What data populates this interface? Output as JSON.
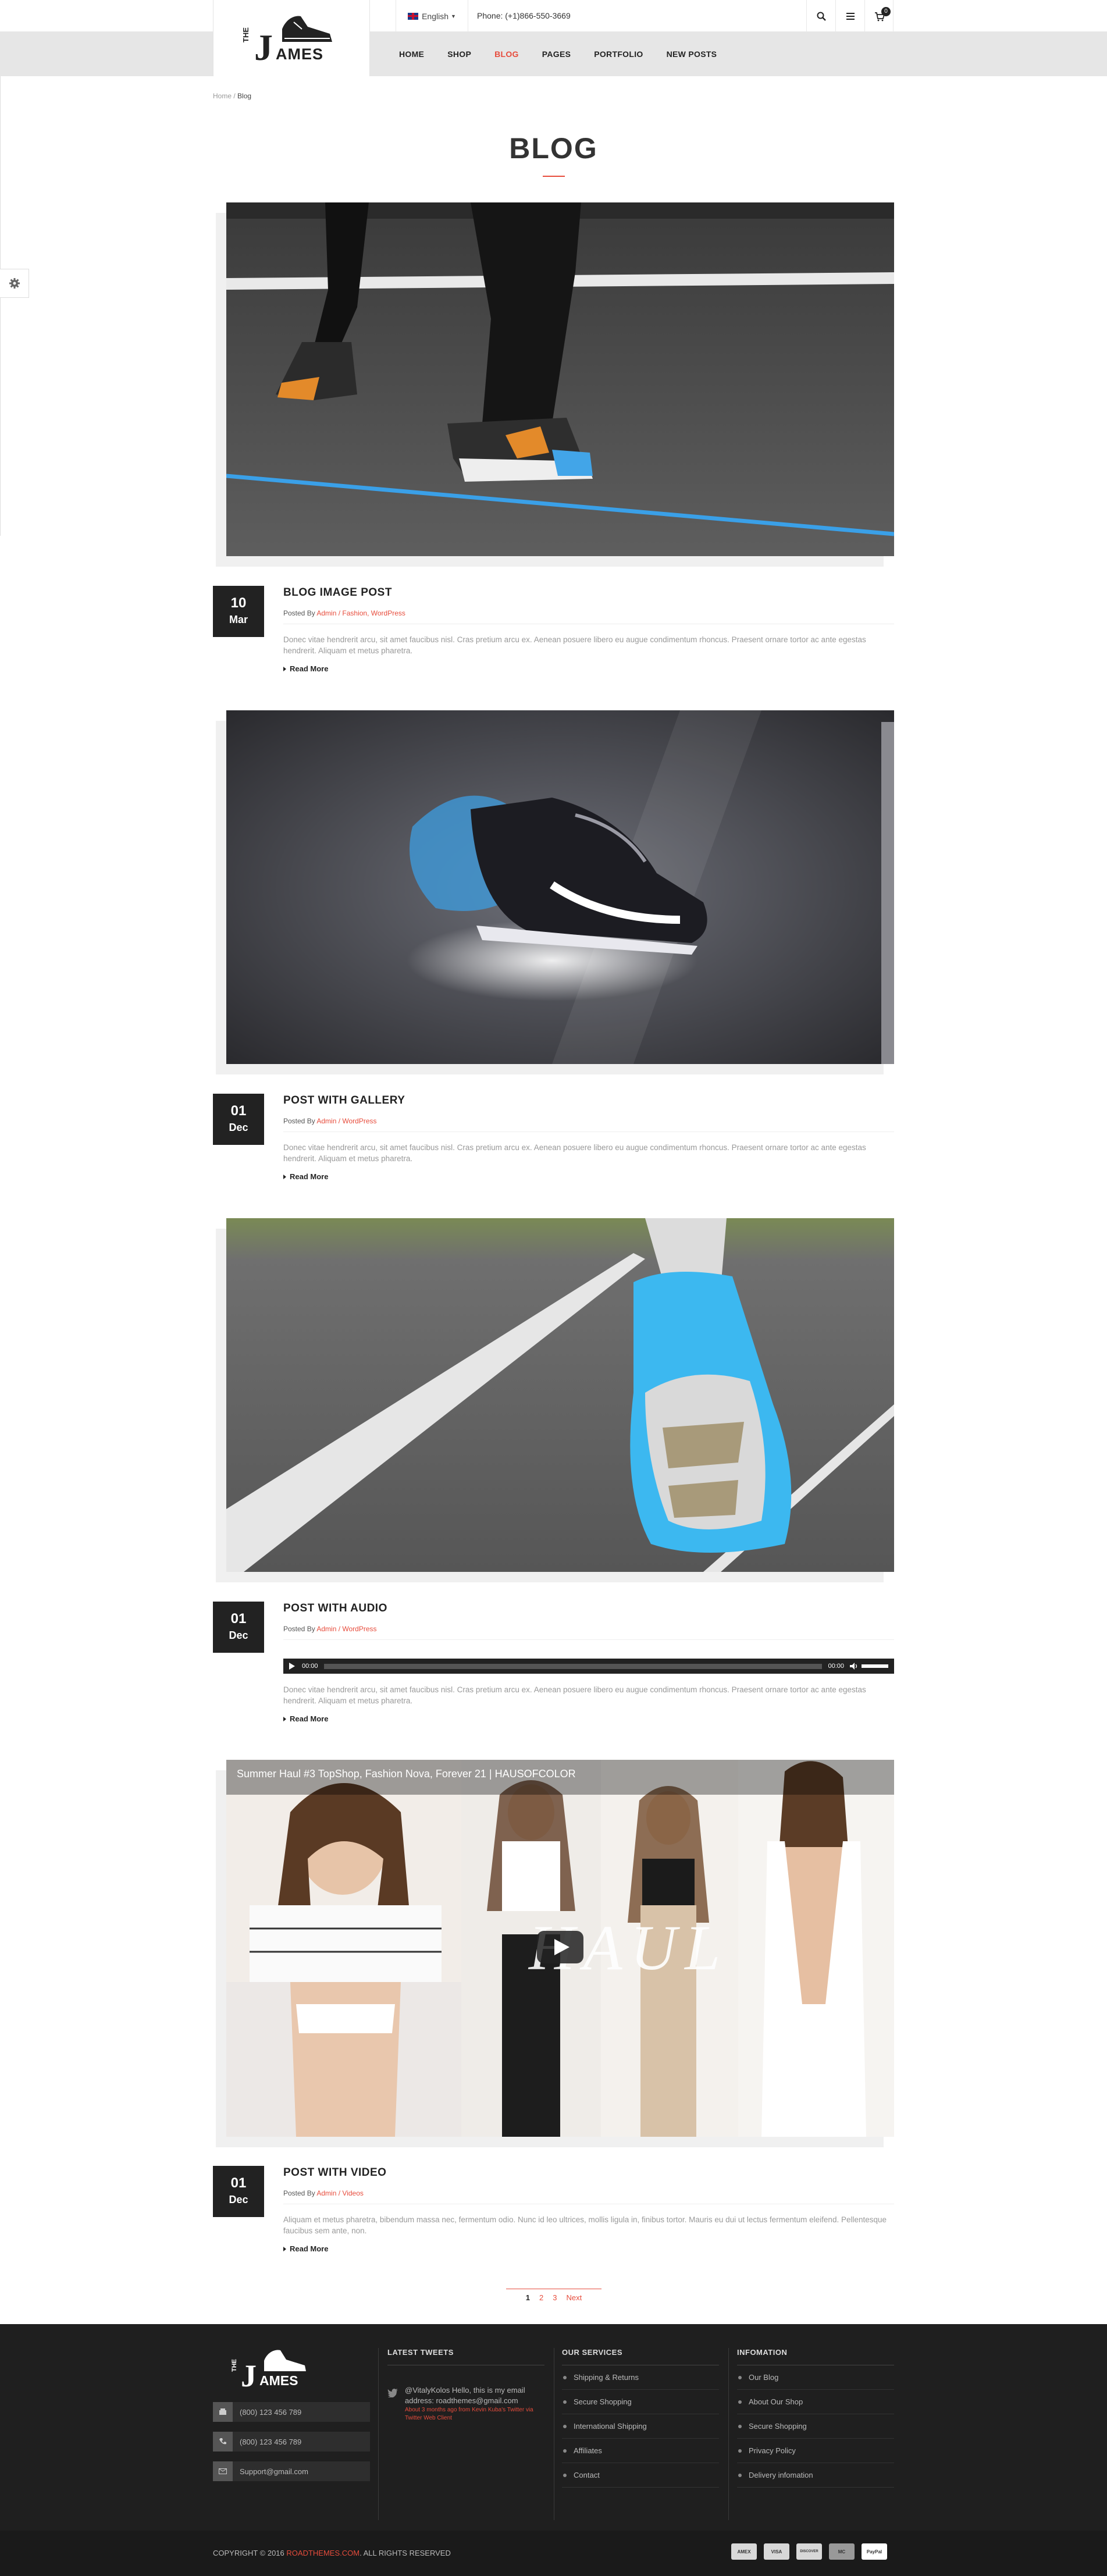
{
  "topbar": {
    "language": "English",
    "phone": "Phone: (+1)866-550-3669",
    "cart_count": "0"
  },
  "brand": {
    "logo_small": "THE",
    "logo_letter": "J",
    "logo_rest": "AMES"
  },
  "nav": {
    "items": [
      {
        "label": "HOME"
      },
      {
        "label": "SHOP"
      },
      {
        "label": "BLOG"
      },
      {
        "label": "PAGES"
      },
      {
        "label": "PORTFOLIO"
      },
      {
        "label": "NEW POSTS"
      }
    ],
    "active": "BLOG"
  },
  "breadcrumb": {
    "home": "Home",
    "separator": "/",
    "current": "Blog"
  },
  "page_title": "BLOG",
  "posts": [
    {
      "day": "10",
      "month": "Mar",
      "title": "BLOG IMAGE POST",
      "posted_by": "Posted By",
      "author": "Admin",
      "categories": "/ Fashion, WordPress",
      "excerpt": "Donec vitae hendrerit arcu, sit amet faucibus nisl. Cras pretium arcu ex. Aenean posuere libero eu augue condimentum rhoncus. Praesent ornare tortor ac ante egestas hendrerit. Aliquam et metus pharetra.",
      "read_more": "Read More"
    },
    {
      "day": "01",
      "month": "Dec",
      "title": "POST WITH GALLERY",
      "posted_by": "Posted By",
      "author": "Admin",
      "categories": "/ WordPress",
      "excerpt": "Donec vitae hendrerit arcu, sit amet faucibus nisl. Cras pretium arcu ex. Aenean posuere libero eu augue condimentum rhoncus. Praesent ornare tortor ac ante egestas hendrerit. Aliquam et metus pharetra.",
      "read_more": "Read More"
    },
    {
      "day": "01",
      "month": "Dec",
      "title": "POST WITH AUDIO",
      "posted_by": "Posted By",
      "author": "Admin",
      "categories": "/ WordPress",
      "excerpt": "Donec vitae hendrerit arcu, sit amet faucibus nisl. Cras pretium arcu ex. Aenean posuere libero eu augue condimentum rhoncus. Praesent ornare tortor ac ante egestas hendrerit. Aliquam et metus pharetra.",
      "read_more": "Read More",
      "audio": {
        "current": "00:00",
        "duration": "00:00"
      }
    },
    {
      "day": "01",
      "month": "Dec",
      "title": "POST WITH VIDEO",
      "posted_by": "Posted By",
      "author": "Admin",
      "categories": "/ Videos",
      "excerpt": "Aliquam et metus pharetra, bibendum massa nec, fermentum odio. Nunc id leo ultrices, mollis ligula in, finibus tortor. Mauris eu dui ut lectus fermentum eleifend. Pellentesque faucibus sem ante, non.",
      "read_more": "Read More",
      "video_title": "Summer Haul #3 TopShop, Fashion Nova, Forever 21 | HAUSOFCOLOR",
      "video_overlay": "HAUL"
    }
  ],
  "pagination": {
    "pages": [
      "1",
      "2",
      "3"
    ],
    "next": "Next",
    "current": "1"
  },
  "footer": {
    "contacts": [
      "(800) 123 456 789",
      "(800) 123 456 789",
      "Support@gmail.com"
    ],
    "tweets_title": "LATEST TWEETS",
    "tweet_text": "@VitalyKolos Hello, this is my email address: roadthemes@gmail.com",
    "tweet_meta": "About 3 months ago from Kevin Kuba's Twitter via Twitter Web Client",
    "services_title": "OUR SERVICES",
    "services": [
      "Shipping & Returns",
      "Secure Shopping",
      "International Shipping",
      "Affiliates",
      "Contact"
    ],
    "info_title": "INFOMATION",
    "info": [
      "Our Blog",
      "About Our Shop",
      "Secure Shopping",
      "Privacy Policy",
      "Delivery infomation"
    ],
    "copyright_prefix": "COPYRIGHT © 2016",
    "copyright_brand": "ROADTHEMES.COM",
    "copyright_suffix": ". ALL RIGHTS RESERVED",
    "payments": [
      "AMEX",
      "VISA",
      "DISCOVER",
      "MC",
      "PayPal"
    ]
  },
  "colors": {
    "accent": "#e74c3c",
    "dark": "#222222",
    "footer": "#1f1f1f"
  }
}
